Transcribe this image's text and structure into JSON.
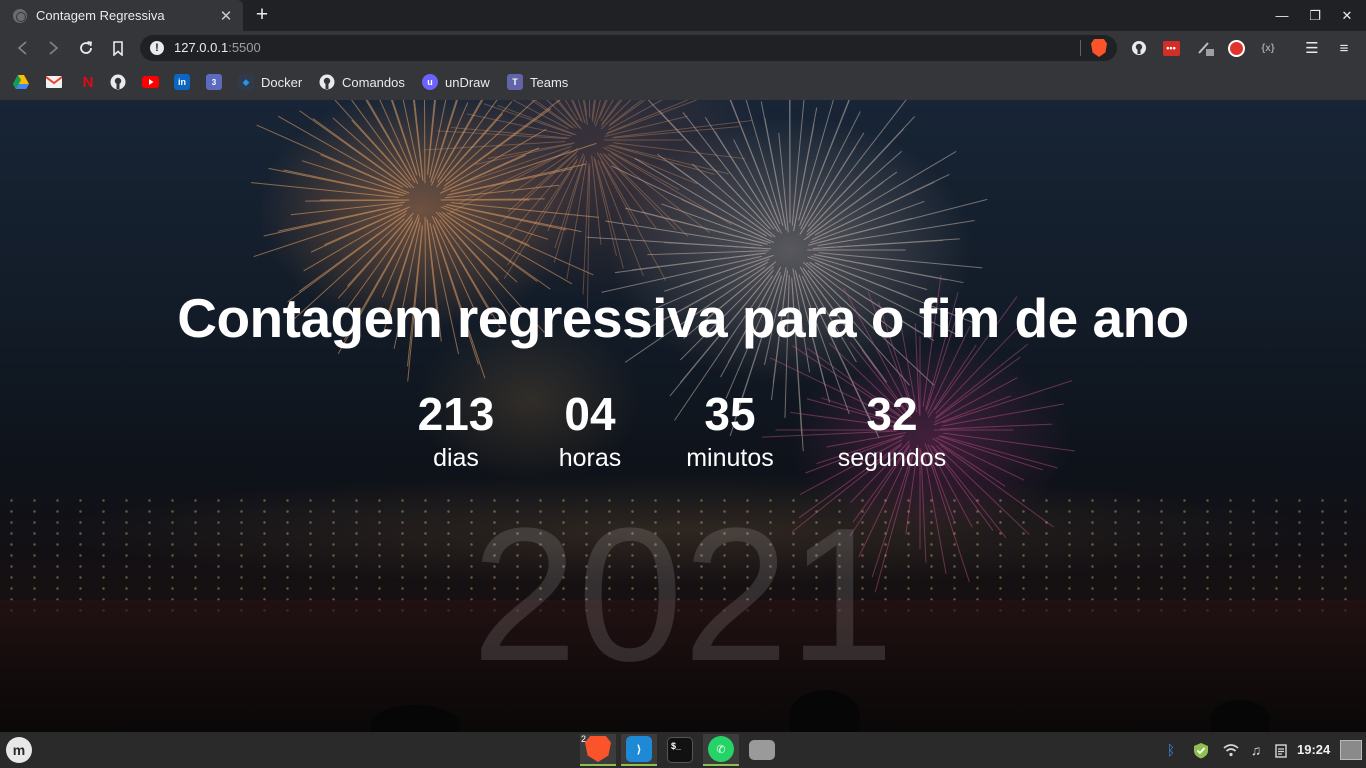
{
  "browser": {
    "tab_title": "Contagem Regressiva",
    "tab_close": "✕",
    "new_tab": "+",
    "url_host": "127.0.0.1",
    "url_port": ":5500",
    "window_controls": {
      "minimize": "—",
      "maximize": "❐",
      "close": "✕"
    }
  },
  "bookmarks": [
    {
      "label": "",
      "icon": "google-drive-icon",
      "color": "#34a853"
    },
    {
      "label": "",
      "icon": "gmail-icon",
      "color": "#ea4335"
    },
    {
      "label": "",
      "icon": "netflix-icon",
      "color": "#e50914"
    },
    {
      "label": "",
      "icon": "github-icon",
      "color": "#e8eaed"
    },
    {
      "label": "",
      "icon": "youtube-icon",
      "color": "#ff0000"
    },
    {
      "label": "",
      "icon": "linkedin-icon",
      "color": "#0a66c2"
    },
    {
      "label": "",
      "icon": "calendar-icon",
      "color": "#d93025"
    },
    {
      "label": "Docker",
      "icon": "docker-icon",
      "color": "#2496ed"
    },
    {
      "label": "Comandos",
      "icon": "github-icon",
      "color": "#e8eaed"
    },
    {
      "label": "unDraw",
      "icon": "undraw-icon",
      "color": "#6c63ff"
    },
    {
      "label": "Teams",
      "icon": "teams-icon",
      "color": "#6264a7"
    }
  ],
  "page": {
    "headline": "Contagem regressiva para o fim de ano",
    "year": "2021",
    "countdown": {
      "days": {
        "value": "213",
        "label": "dias"
      },
      "hours": {
        "value": "04",
        "label": "horas"
      },
      "minutes": {
        "value": "35",
        "label": "minutos"
      },
      "seconds": {
        "value": "32",
        "label": "segundos"
      }
    }
  },
  "taskbar": {
    "brave_window_count": "2",
    "clock": "19:24",
    "apps": [
      "brave-icon",
      "vscode-icon",
      "terminal-icon",
      "whatsapp-icon",
      "files-icon"
    ]
  }
}
